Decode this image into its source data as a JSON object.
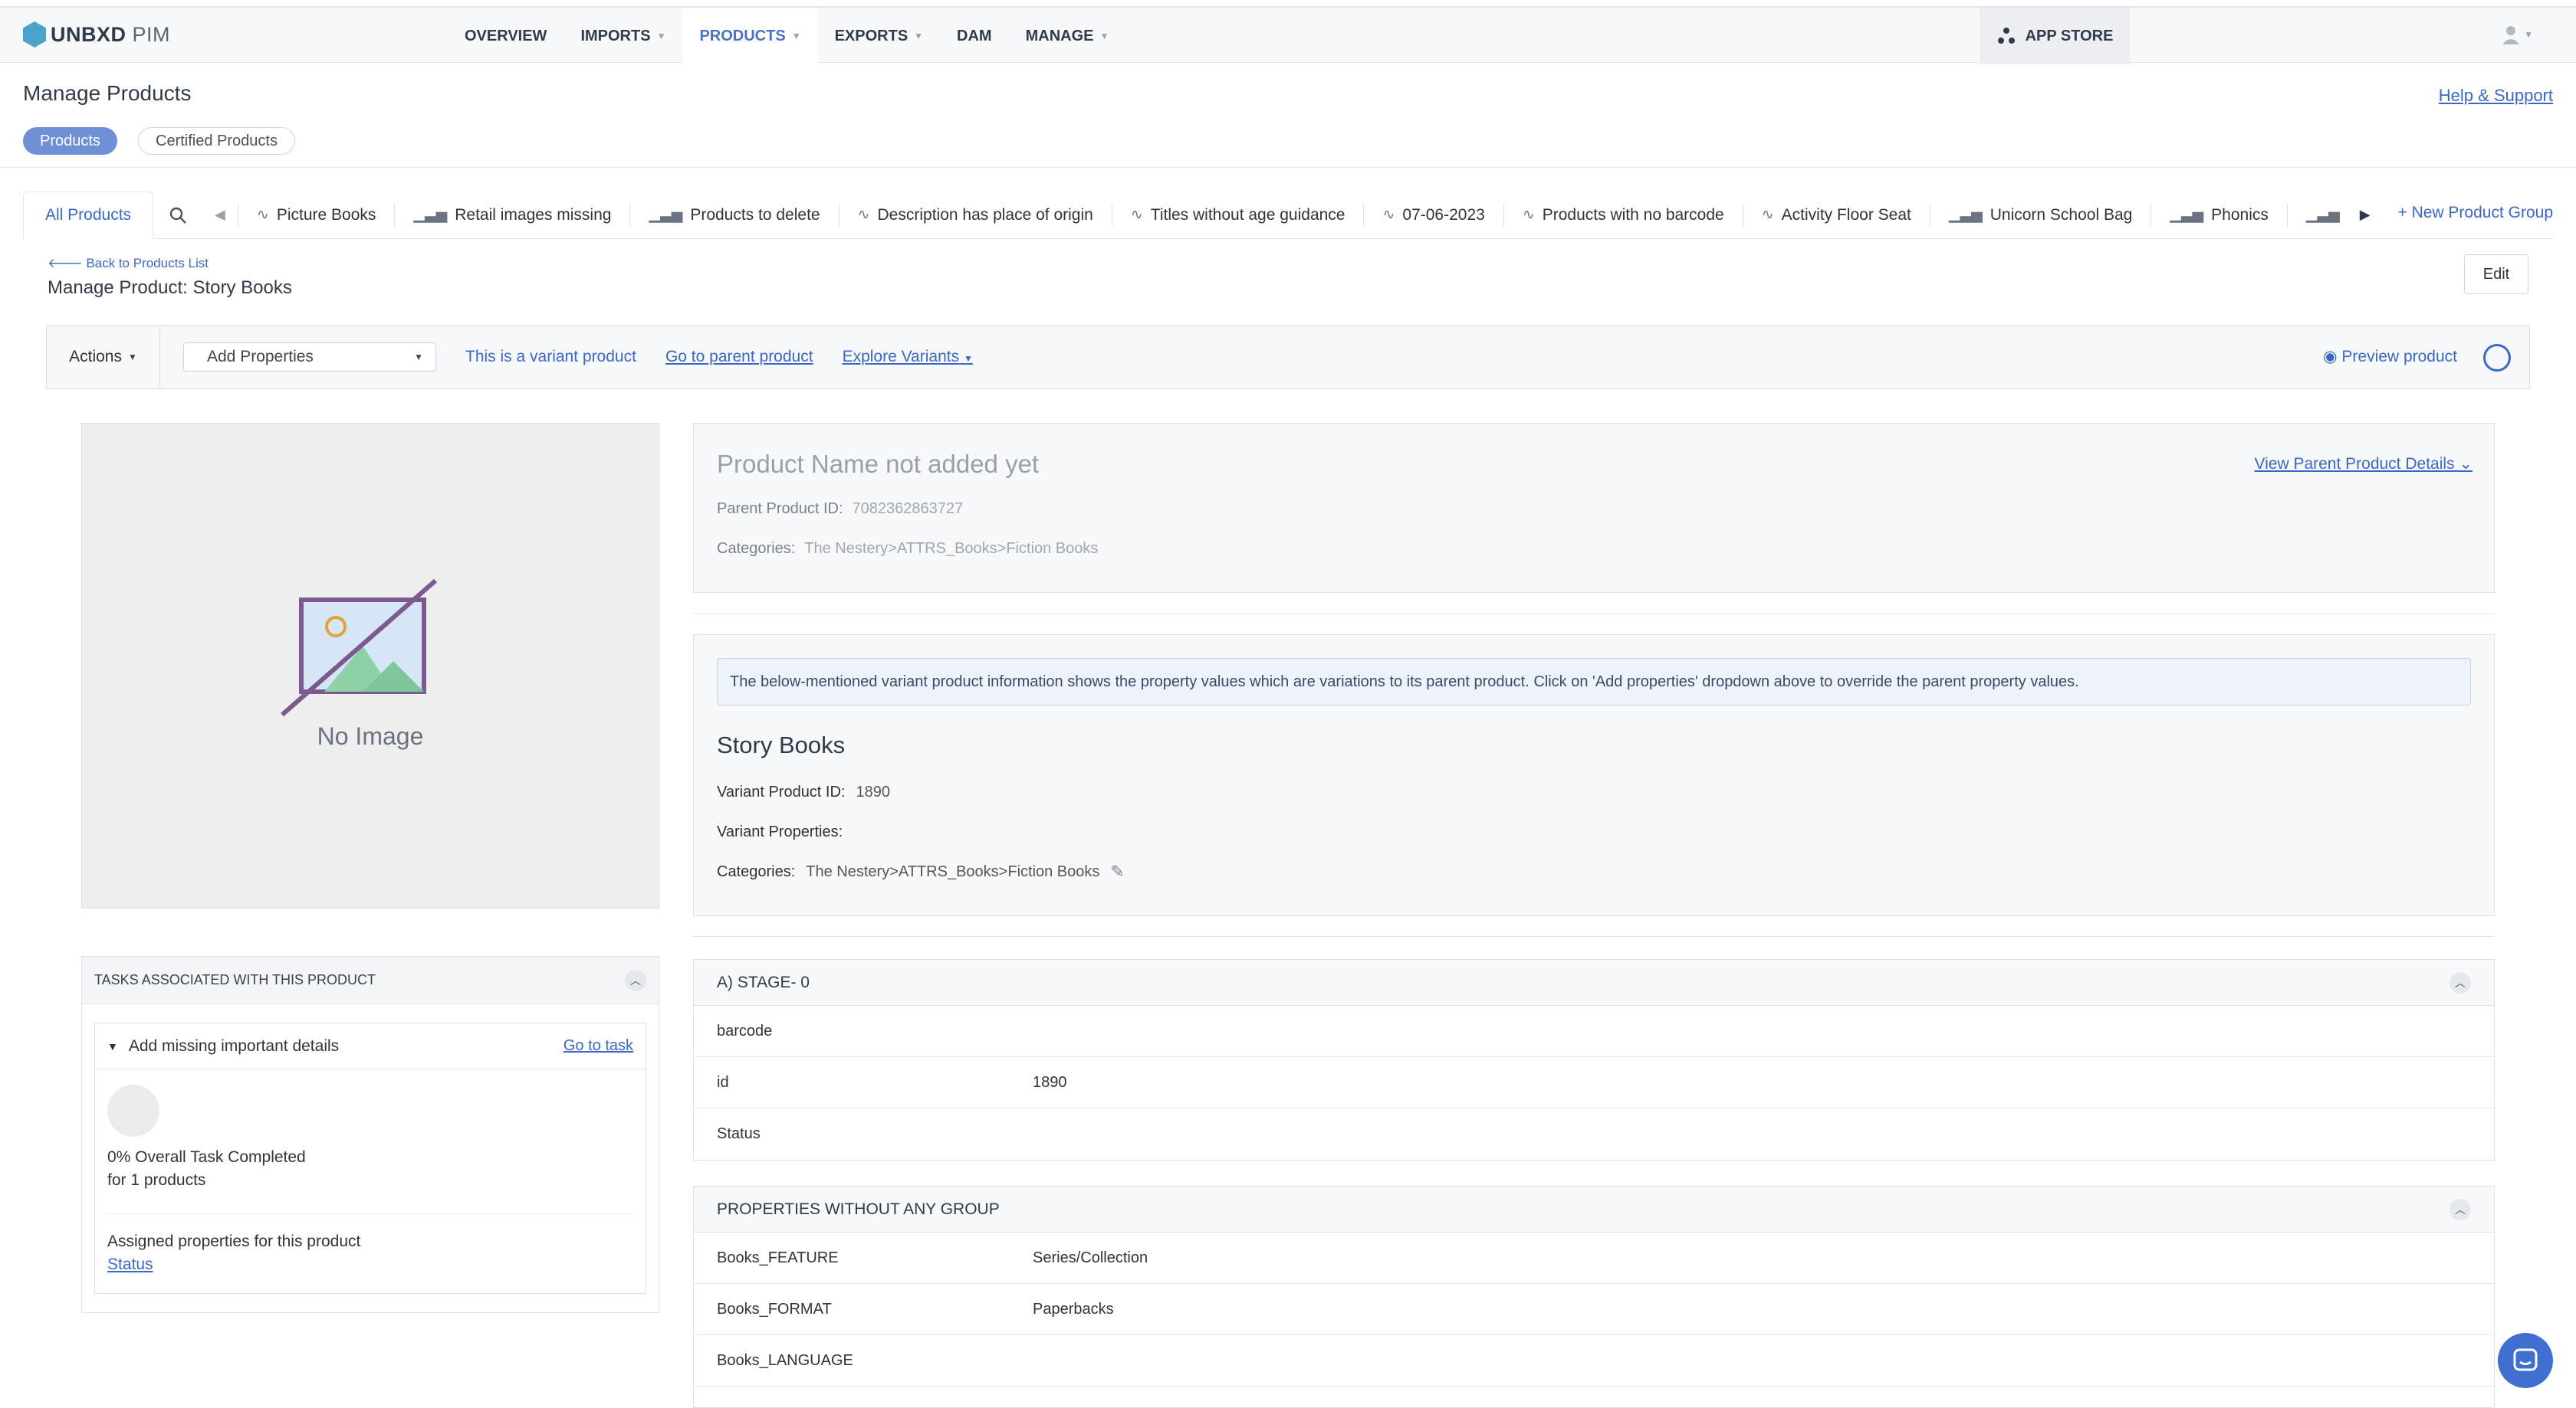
{
  "app": {
    "logo_main": "UNBXD",
    "logo_sub": "PIM"
  },
  "nav": {
    "items": [
      {
        "label": "OVERVIEW",
        "caret": false,
        "active": false
      },
      {
        "label": "IMPORTS",
        "caret": true,
        "active": false
      },
      {
        "label": "PRODUCTS",
        "caret": true,
        "active": true
      },
      {
        "label": "EXPORTS",
        "caret": true,
        "active": false
      },
      {
        "label": "DAM",
        "caret": false,
        "active": false
      },
      {
        "label": "MANAGE",
        "caret": true,
        "active": false
      }
    ],
    "app_store": "APP STORE"
  },
  "page": {
    "title": "Manage Products",
    "help": "Help & Support",
    "pill_products": "Products",
    "pill_certified": "Certified Products"
  },
  "group_tabs": {
    "all": "All Products",
    "items": [
      {
        "icon": "pulse",
        "label": "Picture Books"
      },
      {
        "icon": "bars",
        "label": "Retail images missing"
      },
      {
        "icon": "bars",
        "label": "Products to delete"
      },
      {
        "icon": "pulse",
        "label": "Description has place of origin"
      },
      {
        "icon": "pulse",
        "label": "Titles without age guidance"
      },
      {
        "icon": "pulse",
        "label": "07-06-2023"
      },
      {
        "icon": "pulse",
        "label": "Products with no barcode"
      },
      {
        "icon": "pulse",
        "label": "Activity Floor Seat"
      },
      {
        "icon": "bars",
        "label": "Unicorn School Bag"
      },
      {
        "icon": "bars",
        "label": "Phonics"
      },
      {
        "icon": "bars",
        "label": ""
      }
    ],
    "new_group": "+ New Product Group"
  },
  "product_header": {
    "back": "Back to Products List",
    "title": "Manage Product: Story Books",
    "edit": "Edit"
  },
  "action_bar": {
    "actions": "Actions",
    "add_properties": "Add Properties",
    "variant_note": "This is a variant product",
    "go_parent": "Go to parent product",
    "explore": "Explore Variants",
    "preview": "Preview product"
  },
  "image": {
    "no_image": "No Image"
  },
  "tasks": {
    "title": "TASKS ASSOCIATED WITH THIS PRODUCT",
    "task_name": "Add missing important details",
    "go_to_task": "Go to task",
    "completed": "0% Overall Task Completed",
    "for_products": "for 1 products",
    "assigned": "Assigned properties for this product",
    "assigned_link": "Status"
  },
  "parent": {
    "name_placeholder": "Product Name not added yet",
    "view_parent": "View Parent Product Details",
    "parent_id_label": "Parent Product ID:",
    "parent_id": "7082362863727",
    "categories_label": "Categories:",
    "categories": "The Nestery>ATTRS_Books>Fiction Books"
  },
  "variant": {
    "notice": "The below-mentioned variant product information shows the property values which are variations to its parent product. Click on 'Add properties' dropdown above to override the parent property values.",
    "name": "Story Books",
    "variant_id_label": "Variant Product ID:",
    "variant_id": "1890",
    "variant_props_label": "Variant Properties:",
    "categories_label": "Categories:",
    "categories": "The Nestery>ATTRS_Books>Fiction Books"
  },
  "stage": {
    "title": "A) STAGE- 0",
    "rows": [
      {
        "key": "barcode",
        "value": ""
      },
      {
        "key": "id",
        "value": "1890"
      },
      {
        "key": "Status",
        "value": ""
      }
    ]
  },
  "no_group": {
    "title": "PROPERTIES WITHOUT ANY GROUP",
    "rows": [
      {
        "key": "Books_FEATURE",
        "value": "Series/Collection"
      },
      {
        "key": "Books_FORMAT",
        "value": "Paperbacks"
      },
      {
        "key": "Books_LANGUAGE",
        "value": ""
      }
    ]
  }
}
